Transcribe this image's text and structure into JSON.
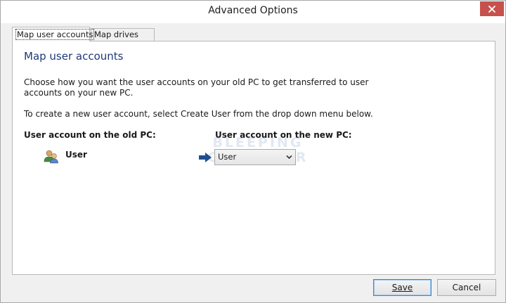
{
  "window": {
    "title": "Advanced Options"
  },
  "tabs": [
    {
      "label": "Map user accounts",
      "active": true
    },
    {
      "label": "Map drives",
      "active": false
    }
  ],
  "panel": {
    "heading": "Map user accounts",
    "description": "Choose how you want the user accounts on your old PC to get transferred to user accounts on your new PC.",
    "hint": "To create a new user account, select Create User from the drop down menu below.",
    "old_column_header": "User account on the old PC:",
    "new_column_header": "User account on the new PC:",
    "old_user_name": "User",
    "new_user_selected": "User"
  },
  "watermark": {
    "line1": "BLEEPING",
    "line2": "COMPUTER"
  },
  "buttons": {
    "save_label": "Save",
    "cancel_label": "Cancel"
  },
  "icons": {
    "close": "close-icon",
    "user_accounts": "users-icon",
    "arrow": "arrow-right-icon",
    "dropdown": "chevron-down-icon"
  },
  "colors": {
    "close_button": "#c7504c",
    "heading": "#1f3a78",
    "arrow": "#1f4f8f",
    "save_border": "#3b86d6"
  }
}
